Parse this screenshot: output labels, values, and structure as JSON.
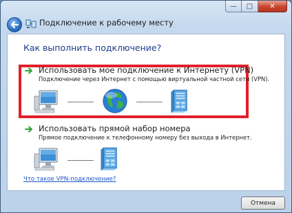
{
  "window": {
    "title": "Подключение к рабочему месту",
    "caption": {
      "minimize": "—",
      "maximize": "□",
      "close": "✕"
    }
  },
  "main": {
    "question": "Как выполнить подключение?",
    "options": [
      {
        "title": "Использовать мое подключение к Интернету (VPN)",
        "description": "Подключение через Интернет с помощью виртуальной частной сети (VPN).",
        "highlighted": true,
        "illustration": [
          "computer-icon",
          "globe-icon",
          "server-icon"
        ]
      },
      {
        "title": "Использовать прямой набор номера",
        "description": "Прямое подключение к телефонному номеру без выхода в Интернет.",
        "highlighted": false,
        "illustration": [
          "computer-icon",
          "server-icon"
        ]
      }
    ],
    "help_link": "Что такое VPN-подключение?"
  },
  "footer": {
    "cancel_label": "Отмена"
  },
  "colors": {
    "highlight": "#e0202a",
    "question": "#1b3b8a",
    "link": "#1a56c8",
    "arrow": "#2fa336"
  }
}
